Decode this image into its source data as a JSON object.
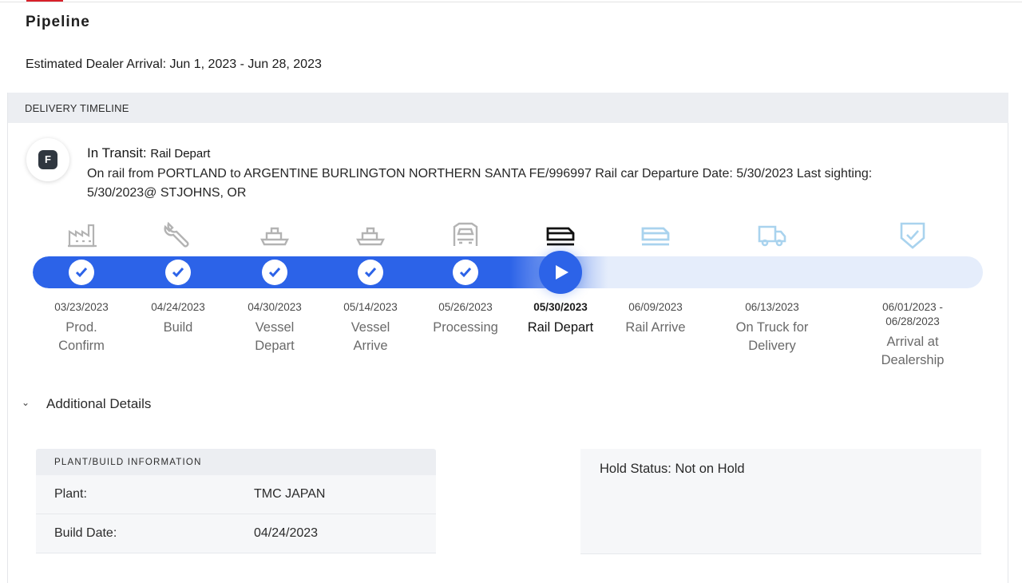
{
  "page": {
    "title": "Pipeline",
    "eta": "Estimated Dealer Arrival: Jun 1, 2023 - Jun 28, 2023"
  },
  "timeline": {
    "header": "DELIVERY TIMELINE",
    "avatar_letter": "F",
    "status_main": "In Transit:",
    "status_sub": "Rail Depart",
    "status_desc": "On rail from PORTLAND to ARGENTINE BURLINGTON NORTHERN SANTA FE/996997 Rail car Departure Date: 5/30/2023 Last sighting: 5/30/2023@ STJOHNS, OR",
    "progress_percent": 55,
    "steps": [
      {
        "date": "03/23/2023",
        "name": "Prod. Confirm",
        "icon": "factory-icon",
        "state": "done"
      },
      {
        "date": "04/24/2023",
        "name": "Build",
        "icon": "wrench-icon",
        "state": "done"
      },
      {
        "date": "04/30/2023",
        "name": "Vessel Depart",
        "icon": "ship-icon",
        "state": "done"
      },
      {
        "date": "05/14/2023",
        "name": "Vessel Arrive",
        "icon": "ship-icon",
        "state": "done"
      },
      {
        "date": "05/26/2023",
        "name": "Processing",
        "icon": "car-front-icon",
        "state": "done"
      },
      {
        "date": "05/30/2023",
        "name": "Rail Depart",
        "icon": "train-icon",
        "state": "current"
      },
      {
        "date": "06/09/2023",
        "name": "Rail Arrive",
        "icon": "train-icon",
        "state": "upcoming"
      },
      {
        "date": "06/13/2023",
        "name": "On Truck for Delivery",
        "icon": "truck-icon",
        "state": "upcoming"
      },
      {
        "date": "06/01/2023 - 06/28/2023",
        "name": "Arrival at Dealership",
        "icon": "shield-check-icon",
        "state": "upcoming"
      }
    ],
    "colors": {
      "accent": "#2c63e8",
      "done_icon": "#b3b3b3",
      "current_icon": "#111111",
      "upcoming_icon": "#a9d3ee"
    }
  },
  "details": {
    "toggle_label": "Additional Details",
    "plant": {
      "header": "PLANT/BUILD INFORMATION",
      "rows": [
        {
          "key": "Plant:",
          "value": "TMC JAPAN"
        },
        {
          "key": "Build Date:",
          "value": "04/24/2023"
        }
      ]
    },
    "hold_status": "Hold Status: Not on Hold"
  }
}
